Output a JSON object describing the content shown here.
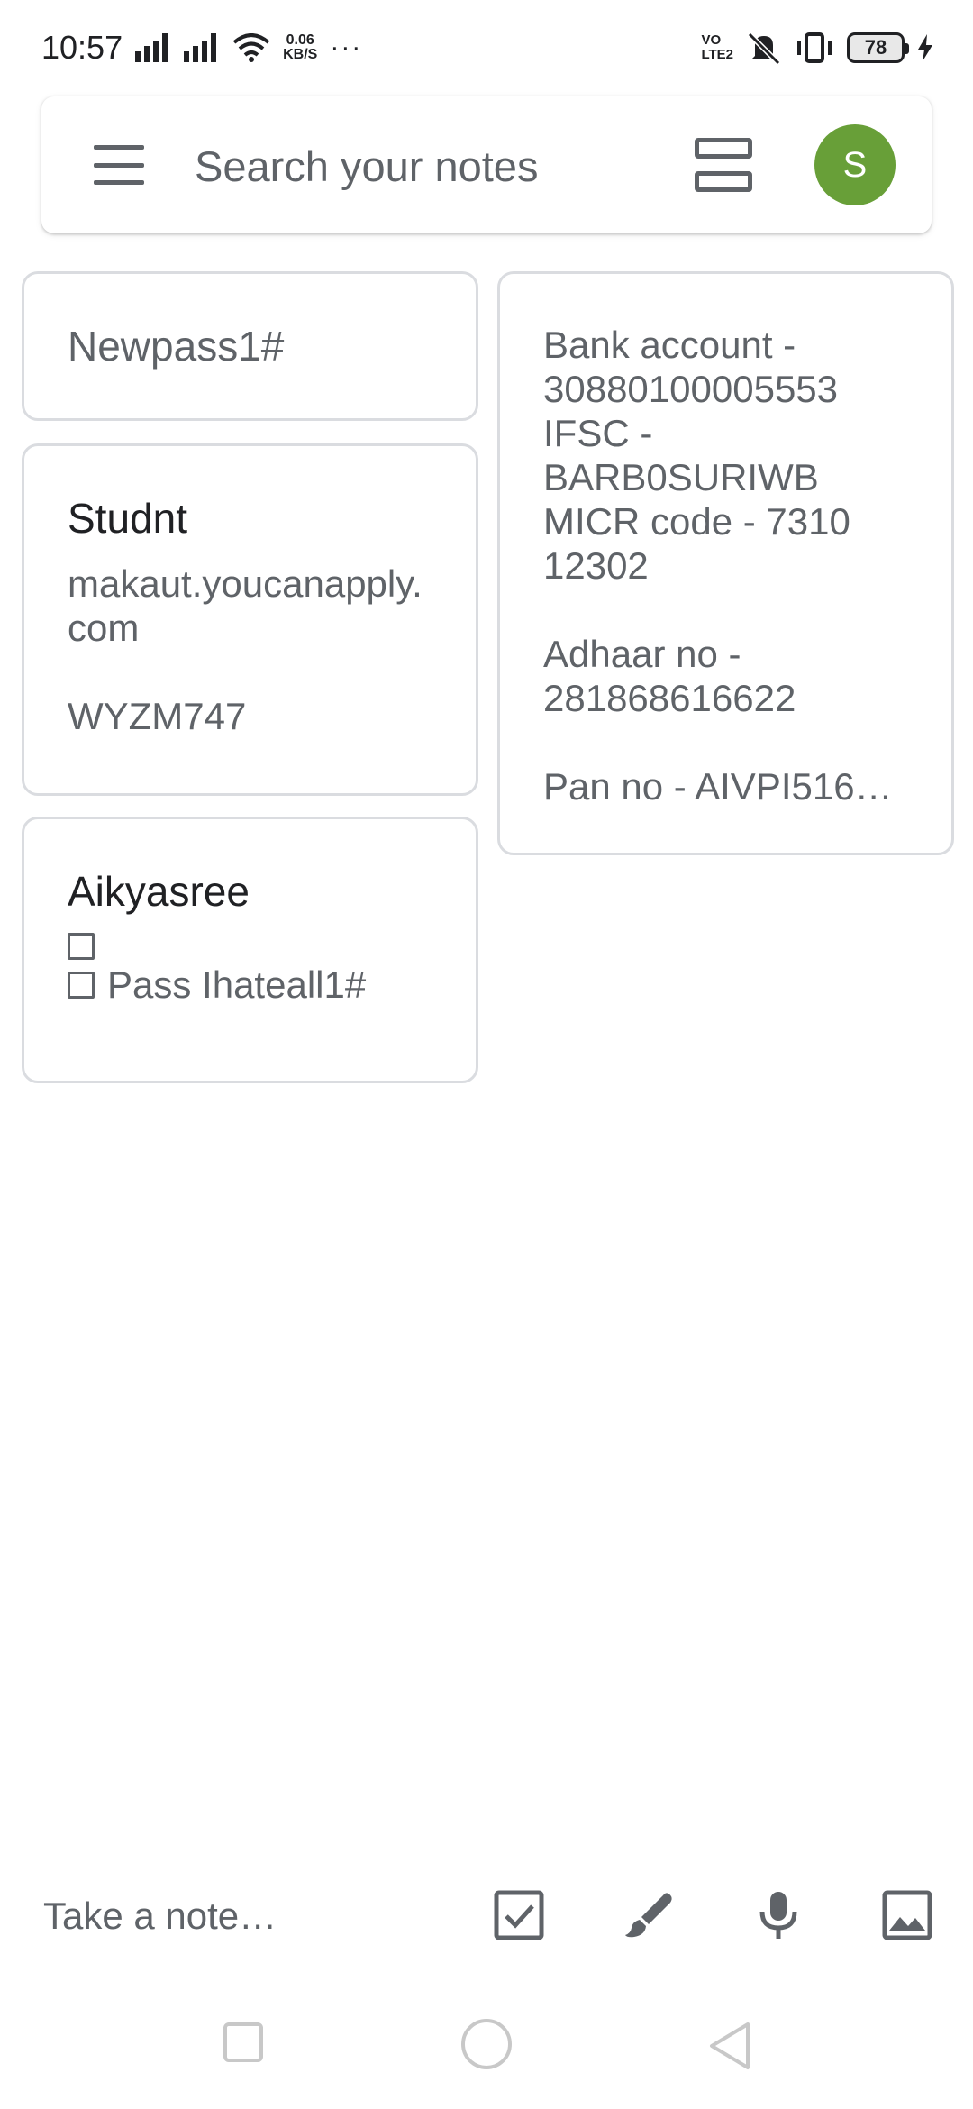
{
  "status_bar": {
    "time": "10:57",
    "speed_value": "0.06",
    "speed_unit": "KB/S",
    "more": "···",
    "volte_top": "VO",
    "volte_bottom": "LTE2",
    "battery": "78"
  },
  "search": {
    "placeholder": "Search your notes",
    "avatar_letter": "S",
    "avatar_color": "#689f38"
  },
  "notes": {
    "newpass": {
      "text": "Newpass1#"
    },
    "studnt": {
      "title": "Studnt",
      "body": "makaut.youcanapply.com\n\nWYZM747"
    },
    "aikyasree": {
      "title": "Aikyasree",
      "items": [
        "",
        "Pass Ihateall1#"
      ]
    },
    "bank": {
      "body": "Bank account -\n30880100005553\nIFSC -\nBARB0SURIWB\nMICR code - 7310\n12302\n\nAdhaar no -\n281868616622\n\nPan no - AIVPI516…"
    }
  },
  "bottom_bar": {
    "take_note": "Take a note…"
  },
  "icons": {
    "menu": "menu-icon",
    "view": "view-list-icon",
    "checkbox": "checkbox-icon",
    "brush": "brush-icon",
    "mic": "mic-icon",
    "image": "image-icon"
  }
}
